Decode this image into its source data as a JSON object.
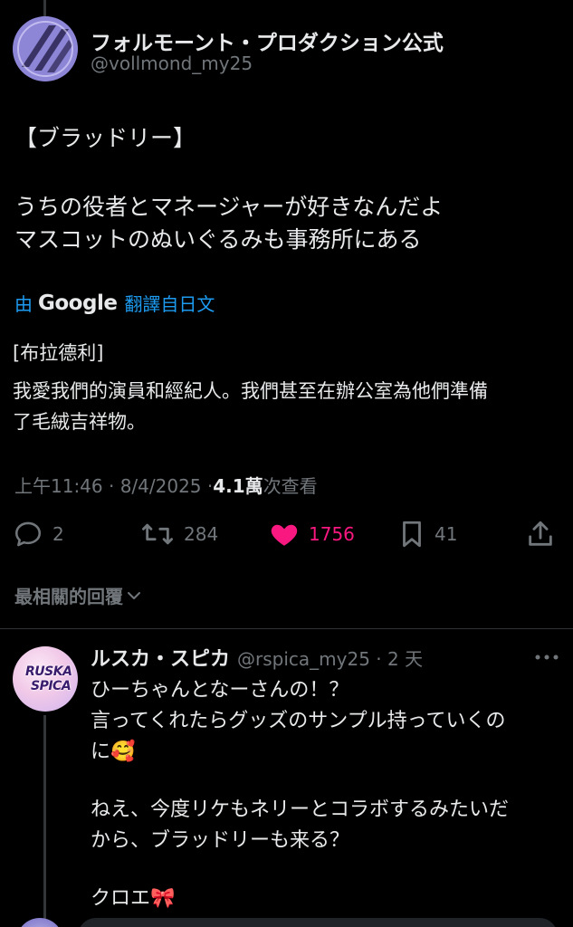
{
  "tweet": {
    "author_name": "フォルモーント・プロダクション公式",
    "author_handle": "@vollmond_my25",
    "text_lines": [
      "【ブラッドリー】",
      "うちの役者とマネージャーが好きなんだよ",
      "マスコットのぬいぐるみも事務所にある"
    ],
    "translation": {
      "by": "由",
      "provider": "Google",
      "source": "翻譯自日文",
      "lines": [
        "[布拉德利]",
        "我愛我們的演員和經紀人。我們甚至在辦公室為他們準備",
        "了毛絨吉祥物。"
      ]
    },
    "timestamp": "上午11:46 · 8/4/2025 · ",
    "views_count": "4.1萬",
    "views_label": " 次查看",
    "stats": {
      "replies": "2",
      "retweets": "284",
      "likes": "1756",
      "bookmarks": "41"
    }
  },
  "replies_section": {
    "label": "最相關的回覆"
  },
  "reply": {
    "author_name": "ルスカ・スピカ",
    "author_handle": "@rspica_my25 · 2 天",
    "avatar_text_1": "RUSKA",
    "avatar_text_2": "SPICA",
    "lines": [
      "ひーちゃんとなーさんの！？",
      "言ってくれたらグッズのサンプル持っていくの",
      "に🥰",
      "ねえ、今度リケもネリーとコラボするみたいだ",
      "から、ブラッドリーも来る？",
      "クロエ🎀"
    ]
  },
  "colors": {
    "background": "#000000",
    "text": "#e7e9ea",
    "muted": "#71767b",
    "link": "#1d9bf0",
    "like": "#f91880"
  },
  "icons": [
    "reply-icon",
    "retweet-icon",
    "heart-icon",
    "bookmark-icon",
    "share-icon",
    "chevron-down-icon",
    "more-icon"
  ]
}
